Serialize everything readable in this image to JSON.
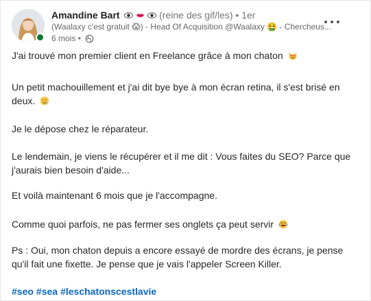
{
  "author": {
    "name": "Amandine Bart",
    "pronoun_note": "(reine des gif/les)",
    "degree": "1er",
    "headline": "(Waalaxy c'est gratuit 😱) - Head Of Acquisition @Waalaxy 🤮 - Chercheus...",
    "time": "6 mois",
    "separator": "•",
    "presence_color": "#0f7a2f"
  },
  "post": {
    "p1": "J'ai trouvé mon premier client en Freelance grâce à mon chaton",
    "p2": "Un petit machouillement et j'ai dit bye bye à mon écran retina, il s'est brisé en deux.",
    "p3": "Je le dépose chez le réparateur.",
    "p4": "Le lendemain, je viens le récupérer et il me dit : Vous faites du SEO? Parce que j'aurais bien besoin d'aide...",
    "p5": "Et voilà maintenant 6 mois que je l'accompagne.",
    "p6": "Comme quoi parfois, ne pas fermer ses onglets ça peut servir",
    "p7": "Ps : Oui, mon chaton depuis a encore essayé de mordre des écrans, je pense qu'il fait une fixette. Je pense que je vais l'appeler Screen Killer.",
    "hashtags": [
      "#seo",
      "#sea",
      "#leschatonscestlavie"
    ]
  },
  "colors": {
    "hashtag": "#0a66c2",
    "muted": "#666666"
  },
  "icons": {
    "eye": "eye-icon",
    "lips": "lips-icon",
    "cat": "cat-heart-eyes-icon",
    "face": "drooling-face-icon",
    "laugh": "laughing-icon",
    "globe": "globe-icon",
    "more": "more-options-icon"
  }
}
